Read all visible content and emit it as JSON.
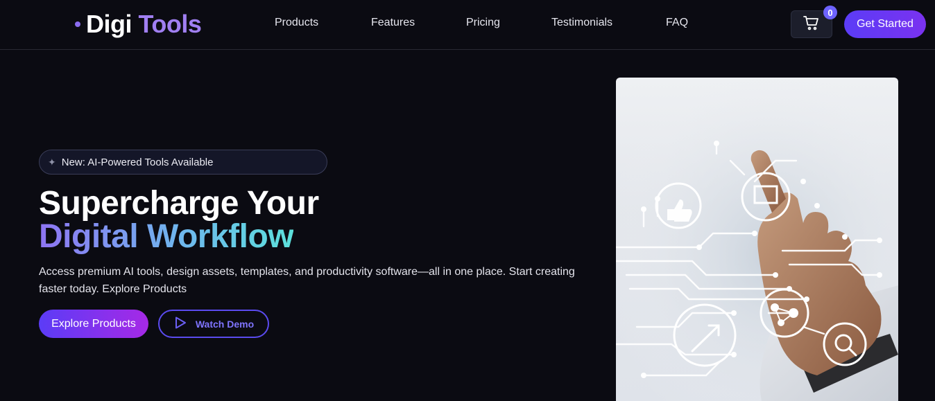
{
  "header": {
    "logo_part1": "Digi",
    "logo_part2": "Tools",
    "nav": [
      "Products",
      "Features",
      "Pricing",
      "Testimonials",
      "FAQ"
    ],
    "cart_count": "0",
    "cta_label": "Get Started"
  },
  "hero": {
    "badge": "New: AI-Powered Tools Available",
    "title_line1": "Supercharge Your",
    "title_line2": "Digital Workflow",
    "description": "Access premium AI tools, design assets, templates, and productivity software—all in one place. Start creating faster today. Explore Products",
    "primary_button": "Explore Products",
    "secondary_button": "Watch Demo"
  },
  "colors": {
    "background": "#0b0b12",
    "accent": "#5b3cf6",
    "accent_purple": "#a629e6",
    "logo_accent": "#a07ff2",
    "gradient_end": "#5ce0db"
  },
  "icons": {
    "cart": "shopping-cart-icon",
    "badge": "sparkle-icon",
    "demo": "play-icon"
  }
}
